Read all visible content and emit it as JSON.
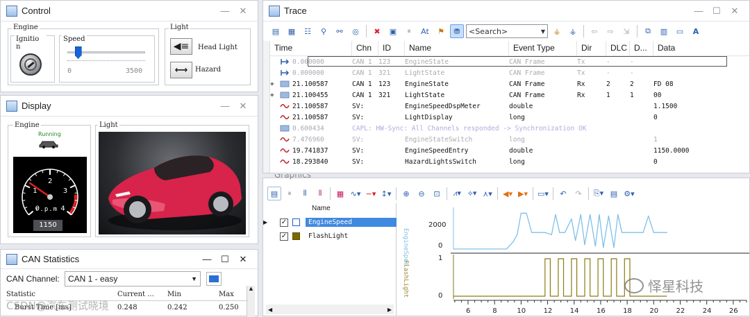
{
  "control": {
    "title": "Control",
    "engine_label": "Engine",
    "ignition_label": "Ignitio n",
    "speed_label": "Speed",
    "speed_min": "0",
    "speed_max": "3500",
    "speed_fraction": 0.13,
    "light_label": "Light",
    "headlight_label": "Head Light",
    "hazard_label": "Hazard"
  },
  "display": {
    "title": "Display",
    "engine_label": "Engine",
    "running_text": "Running",
    "light_label": "Light",
    "rpm_unit": "r.p.m",
    "rpm_value": "1150",
    "gauge_ticks": [
      "0",
      "1",
      "2",
      "3",
      "4"
    ],
    "gauge_value": 1.15
  },
  "stats": {
    "title": "CAN Statistics",
    "channel_label": "CAN Channel:",
    "channel_value": "CAN 1 - easy",
    "headers": [
      "Statistic",
      "Current ...",
      "Min",
      "Max"
    ],
    "row": [
      "Burst Time [ms]",
      "0.248",
      "0.242",
      "0.250"
    ]
  },
  "trace": {
    "title": "Trace",
    "search_placeholder": "<Search>",
    "columns": [
      "Time",
      "Chn",
      "ID",
      "Name",
      "Event Type",
      "Dir",
      "DLC",
      "D...",
      "Data"
    ],
    "rows": [
      {
        "time": "0.000000",
        "chn": "CAN 1",
        "id": "123",
        "name": "EngineState",
        "evt": "CAN Frame",
        "dir": "Tx",
        "dlc": "-",
        "d": "-",
        "data": "",
        "grey": true,
        "icon": "frame"
      },
      {
        "time": "0.000000",
        "chn": "CAN 1",
        "id": "321",
        "name": "LightState",
        "evt": "CAN Frame",
        "dir": "Tx",
        "dlc": "-",
        "d": "-",
        "data": "",
        "grey": true,
        "icon": "frame"
      },
      {
        "time": "21.100587",
        "chn": "CAN 1",
        "id": "123",
        "name": "EngineState",
        "evt": "CAN Frame",
        "dir": "Rx",
        "dlc": "2",
        "d": "2",
        "data": "FD 08",
        "grey": false,
        "icon": "msg",
        "exp": "+"
      },
      {
        "time": "21.100455",
        "chn": "CAN 1",
        "id": "321",
        "name": "LightState",
        "evt": "CAN Frame",
        "dir": "Rx",
        "dlc": "1",
        "d": "1",
        "data": "00",
        "grey": false,
        "icon": "msg",
        "exp": "+"
      },
      {
        "time": "21.100587",
        "chn": "SV:",
        "id": "",
        "name": "EngineSpeedDspMeter",
        "evt": "double",
        "dir": "",
        "dlc": "",
        "d": "",
        "data": "1.1500",
        "grey": false,
        "icon": "sig"
      },
      {
        "time": "21.100587",
        "chn": "SV:",
        "id": "",
        "name": "LightDisplay",
        "evt": "long",
        "dir": "",
        "dlc": "",
        "d": "",
        "data": "0",
        "grey": false,
        "icon": "sig"
      },
      {
        "time": "0.600434",
        "chn": "CAPL: HW-Sync: All Channels responded -> Synchronization OK",
        "id": "",
        "name": "",
        "evt": "",
        "dir": "",
        "dlc": "",
        "d": "",
        "data": "",
        "grey": true,
        "icon": "msg",
        "capl": true
      },
      {
        "time": "7.476960",
        "chn": "SV:",
        "id": "",
        "name": "EngineStateSwitch",
        "evt": "long",
        "dir": "",
        "dlc": "",
        "d": "",
        "data": "1",
        "grey": true,
        "icon": "sig"
      },
      {
        "time": "19.741837",
        "chn": "SV:",
        "id": "",
        "name": "EngineSpeedEntry",
        "evt": "double",
        "dir": "",
        "dlc": "",
        "d": "",
        "data": "1150.0000",
        "grey": false,
        "icon": "sig"
      },
      {
        "time": "18.293840",
        "chn": "SV:",
        "id": "",
        "name": "HazardLightsSwitch",
        "evt": "long",
        "dir": "",
        "dlc": "",
        "d": "",
        "data": "0",
        "grey": false,
        "icon": "sig"
      }
    ]
  },
  "graphics": {
    "title": "Graphics",
    "name_header": "Name",
    "signals": [
      {
        "name": "EngineSpeed",
        "color": "#1e5fd0",
        "selected": true
      },
      {
        "name": "FlashLight",
        "color": "#7a6a00",
        "selected": false
      }
    ],
    "axis_label_speed": "EngineSpee",
    "axis_label_flash": "FlashLight",
    "speed_ticks": [
      "2000",
      "0"
    ],
    "flash_ticks": [
      "1",
      "0"
    ],
    "x_ticks": [
      "6",
      "8",
      "10",
      "12",
      "14",
      "16",
      "18",
      "20",
      "22",
      "24",
      "26"
    ]
  },
  "chart_data": {
    "type": "line",
    "x": [
      4.9,
      8.9,
      9.4,
      9.7,
      10.0,
      10.4,
      10.8,
      11.3,
      11.8,
      12.3,
      12.6,
      12.9,
      13.3,
      13.8,
      14.1,
      14.5,
      14.8,
      15.2,
      15.6,
      15.9,
      16.2,
      16.6,
      17.0,
      17.3,
      17.6,
      18.0,
      18.4,
      18.8,
      19.2,
      19.6,
      20.0,
      21.0
    ],
    "series": [
      {
        "name": "EngineSpeed",
        "color": "#7fc0e8",
        "values": [
          0,
          0,
          500,
          1000,
          2500,
          2500,
          1150,
          1150,
          1150,
          1000,
          2400,
          1150,
          1150,
          2100,
          600,
          2400,
          300,
          2400,
          200,
          2400,
          100,
          2300,
          100,
          2400,
          1150,
          1150,
          1150,
          1150,
          1150,
          2300,
          1150,
          1150
        ]
      },
      {
        "name": "FlashLight",
        "color": "#8a7a10"
      }
    ],
    "flash_x": [
      4.9,
      11.8,
      11.8,
      12.2,
      12.2,
      12.8,
      12.8,
      13.2,
      13.2,
      13.8,
      13.8,
      14.2,
      14.2,
      14.8,
      14.8,
      15.2,
      15.2,
      15.8,
      15.8,
      16.2,
      16.2,
      16.8,
      16.8,
      17.2,
      17.2,
      17.8,
      17.8,
      18.2,
      18.2,
      21.0
    ],
    "flash_values": [
      0,
      0,
      1,
      1,
      0,
      0,
      1,
      1,
      0,
      0,
      1,
      1,
      0,
      0,
      1,
      1,
      0,
      0,
      1,
      1,
      0,
      0,
      1,
      1,
      0,
      0,
      1,
      1,
      0,
      0
    ],
    "xlim": [
      4.9,
      27.0
    ],
    "speed_ylim": [
      0,
      2900
    ],
    "flash_ylim": [
      0,
      1
    ]
  },
  "watermark": {
    "left": "CSDN@汽车测试晓境",
    "right": "怿星科技"
  }
}
